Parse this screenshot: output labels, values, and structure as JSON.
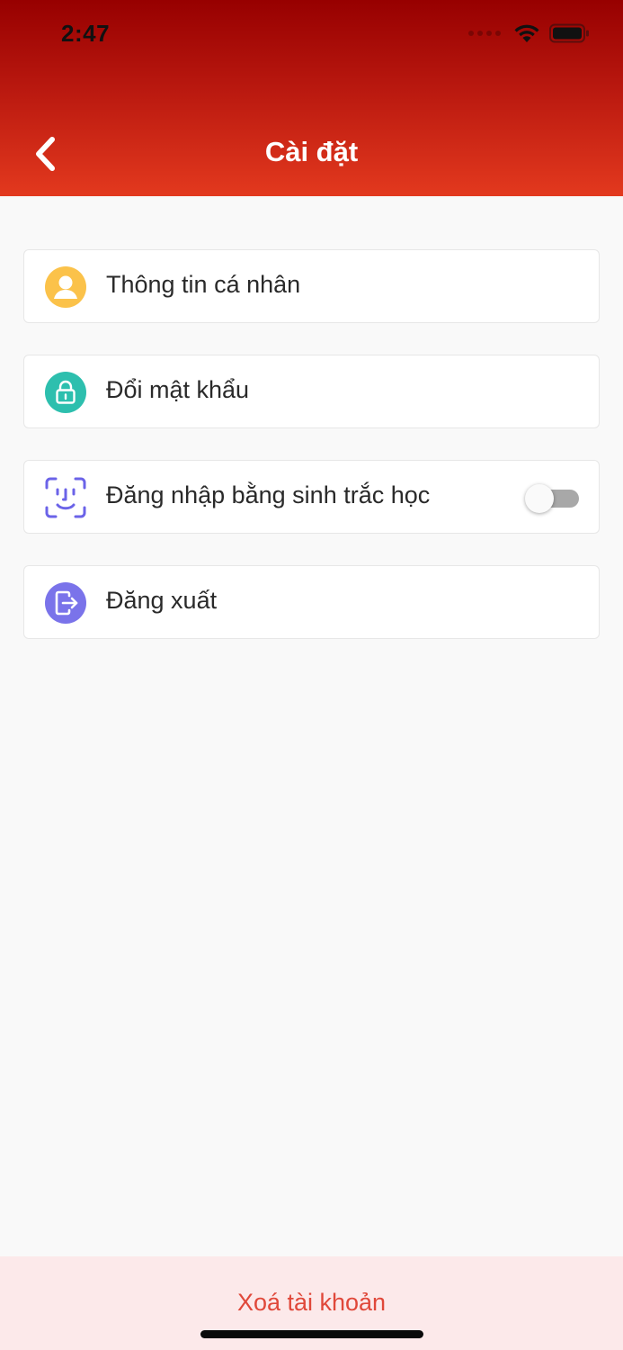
{
  "status_bar": {
    "time": "2:47",
    "icons": [
      "cellular-dots-icon",
      "wifi-icon",
      "battery-icon"
    ]
  },
  "header": {
    "title": "Cài đặt",
    "back_icon": "chevron-left-icon",
    "gradient": [
      "#970000",
      "#e3391e"
    ]
  },
  "settings": {
    "items": [
      {
        "label": "Thông tin cá nhân",
        "icon": "user-icon",
        "icon_color": "#fbc24a"
      },
      {
        "label": "Đổi mật khẩu",
        "icon": "lock-icon",
        "icon_color": "#2dbfae"
      },
      {
        "label": "Đăng nhập bằng sinh trắc học",
        "icon": "face-id-icon",
        "icon_color": "#6b63e8",
        "toggle_on": false
      },
      {
        "label": "Đăng xuất",
        "icon": "logout-icon",
        "icon_color": "#7a73ea"
      }
    ]
  },
  "footer": {
    "delete_account_label": "Xoá tài khoản",
    "accent": "#e0483a",
    "background": "#fce9ea"
  }
}
